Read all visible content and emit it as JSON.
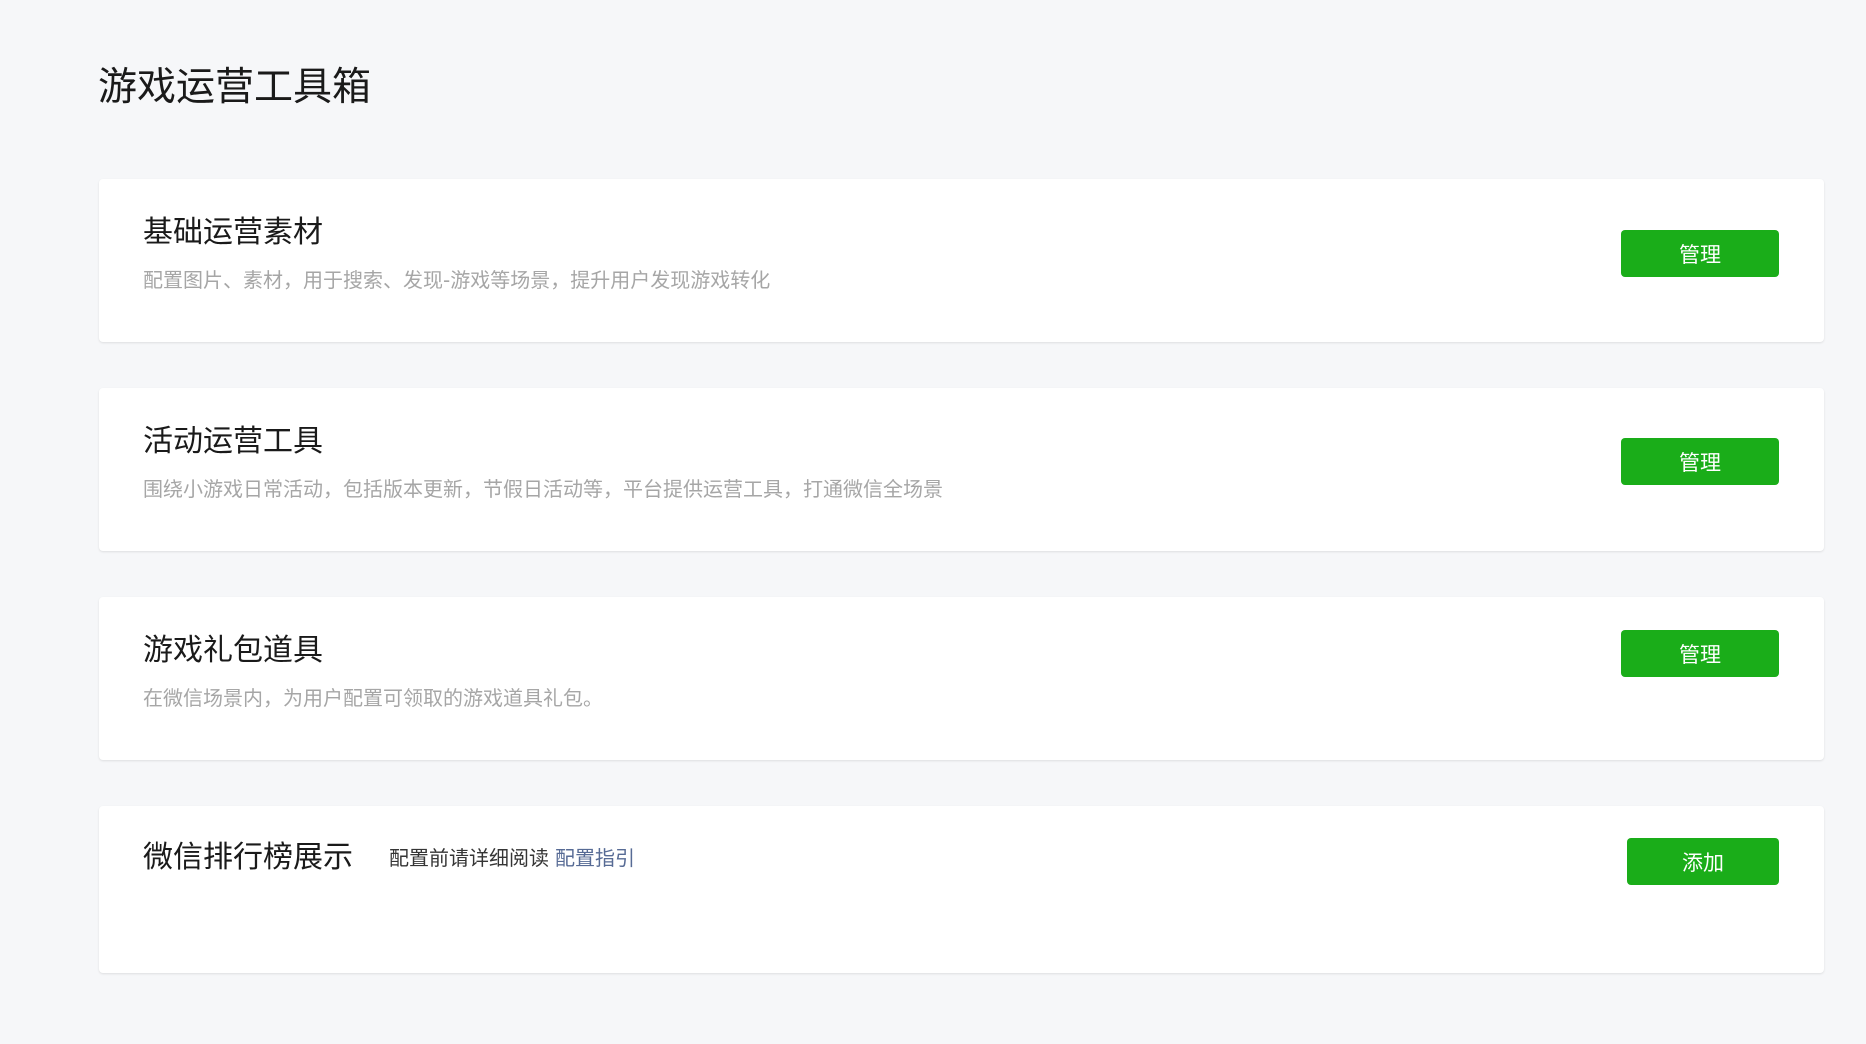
{
  "page": {
    "title": "游戏运营工具箱"
  },
  "cards": [
    {
      "title": "基础运营素材",
      "description": "配置图片、素材，用于搜索、发现-游戏等场景，提升用户发现游戏转化",
      "button_label": "管理"
    },
    {
      "title": "活动运营工具",
      "description": "围绕小游戏日常活动，包括版本更新，节假日活动等，平台提供运营工具，打通微信全场景",
      "button_label": "管理"
    },
    {
      "title": "游戏礼包道具",
      "description": "在微信场景内，为用户配置可领取的游戏道具礼包。",
      "button_label": "管理"
    },
    {
      "title": "微信排行榜展示",
      "note": "配置前请详细阅读",
      "link_label": "配置指引",
      "button_label": "添加"
    }
  ],
  "colors": {
    "background": "#f6f7f9",
    "card": "#ffffff",
    "primary_button": "#1aad19",
    "link": "#576b95",
    "muted_text": "#a6a6a6"
  }
}
